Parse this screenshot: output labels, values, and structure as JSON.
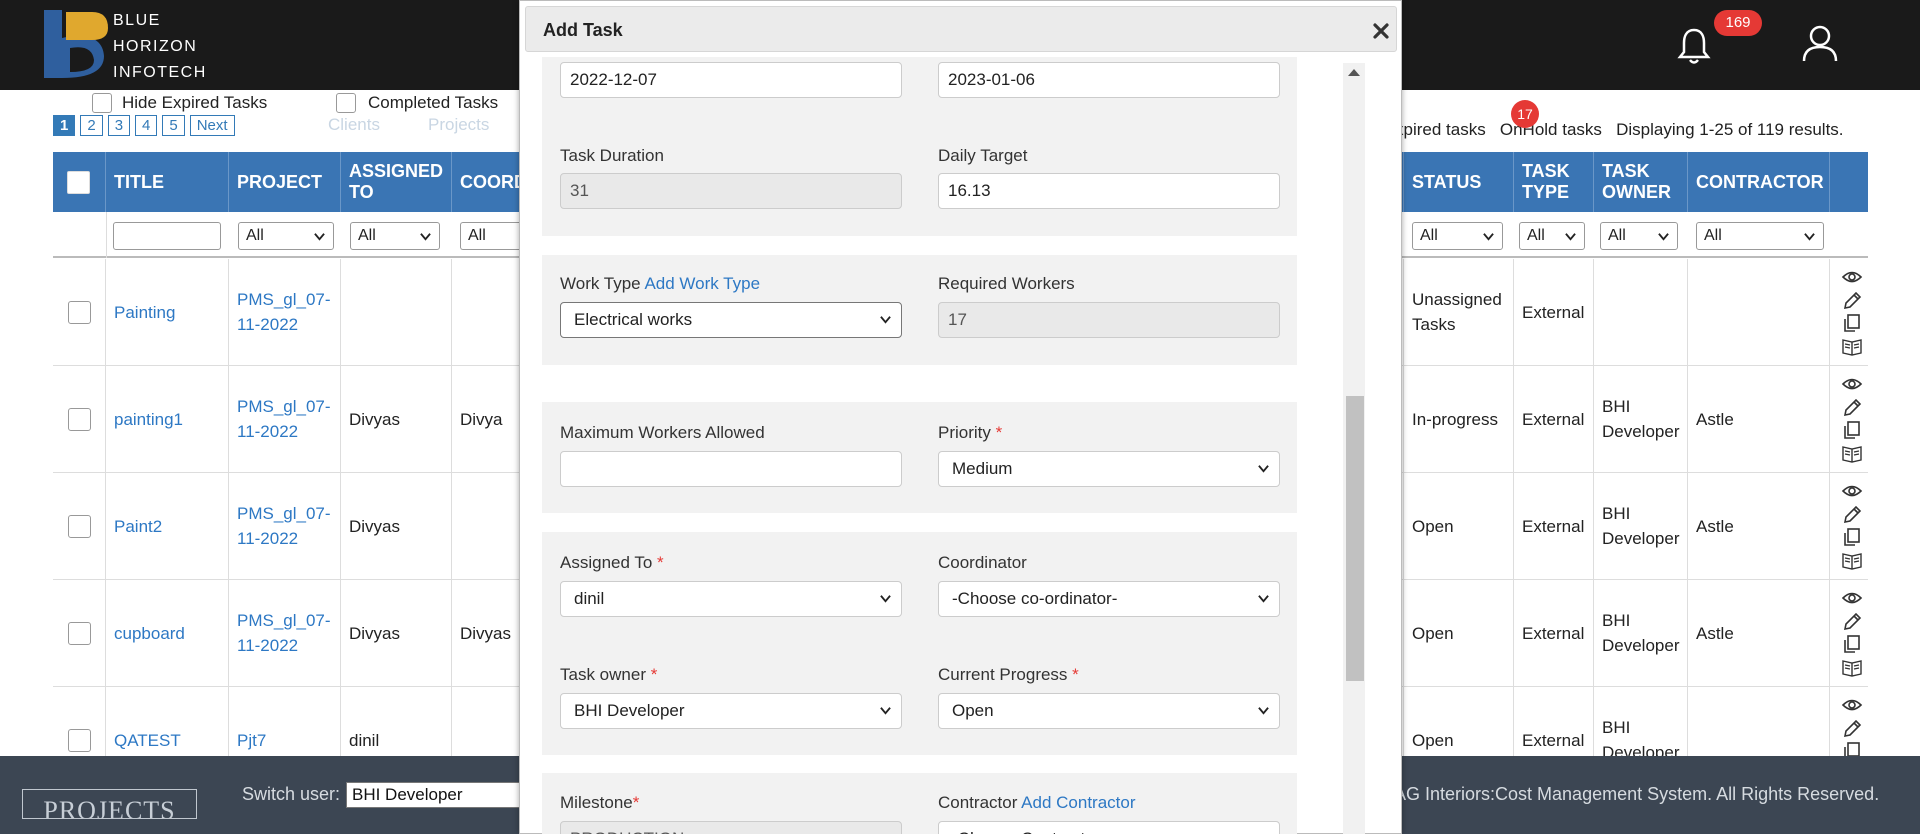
{
  "brand": {
    "line1": "BLUE",
    "line2": "HORIZON",
    "line3": "INFOTECH"
  },
  "header": {
    "notification_count": "169"
  },
  "filters": {
    "hide_expired": "Hide Expired Tasks",
    "completed": "Completed Tasks"
  },
  "pager": [
    "1",
    "2",
    "3",
    "4",
    "5",
    "Next"
  ],
  "ghost_nav": {
    "clients": "Clients",
    "projects": "Projects"
  },
  "task_links": {
    "expired": "xpired tasks",
    "onhold": "OnHold tasks",
    "displaying": "Displaying 1-25 of 119 results.",
    "badge": "17"
  },
  "columns": {
    "title": "TITLE",
    "project": "PROJECT",
    "assigned1": "ASSIGNED",
    "assigned2": "TO",
    "coordinator": "COORD",
    "status": "STATUS",
    "task_type1": "TASK",
    "task_type2": "TYPE",
    "task_owner1": "TASK",
    "task_owner2": "OWNER",
    "contractor": "CONTRACTOR"
  },
  "filter_all": "All",
  "rows": [
    {
      "title": "Painting",
      "project1": "PMS_gl_07-",
      "project2": "11-2022",
      "assigned": "",
      "coordinator": "",
      "status1": "Unassigned",
      "status2": "Tasks",
      "type": "External",
      "owner1": "",
      "owner2": "",
      "contractor": ""
    },
    {
      "title": "painting1",
      "project1": "PMS_gl_07-",
      "project2": "11-2022",
      "assigned": "Divyas",
      "coordinator": "Divya",
      "status1": "In-progress",
      "status2": "",
      "type": "External",
      "owner1": "BHI",
      "owner2": "Developer",
      "contractor": "Astle"
    },
    {
      "title": "Paint2",
      "project1": "PMS_gl_07-",
      "project2": "11-2022",
      "assigned": "Divyas",
      "coordinator": "",
      "status1": "Open",
      "status2": "",
      "type": "External",
      "owner1": "BHI",
      "owner2": "Developer",
      "contractor": "Astle"
    },
    {
      "title": "cupboard",
      "project1": "PMS_gl_07-",
      "project2": "11-2022",
      "assigned": "Divyas",
      "coordinator": "Divyas",
      "status1": "Open",
      "status2": "",
      "type": "External",
      "owner1": "BHI",
      "owner2": "Developer",
      "contractor": "Astle"
    },
    {
      "title": "QATEST",
      "project1": "Pjt7",
      "project2": "",
      "assigned": "dinil",
      "coordinator": "",
      "status1": "Open",
      "status2": "",
      "type": "External",
      "owner1": "BHI",
      "owner2": "Developer",
      "contractor": ""
    }
  ],
  "footer": {
    "projects": "PROJECTS",
    "switch_user": "Switch user:",
    "user": "BHI Developer",
    "copyright": "AG Interiors:Cost Management System. All Rights Reserved."
  },
  "modal": {
    "title": "Add Task",
    "start_date": "2022-12-07",
    "end_date": "2023-01-06",
    "task_duration_label": "Task Duration",
    "task_duration": "31",
    "daily_target_label": "Daily Target",
    "daily_target": "16.13",
    "work_type_label": "Work Type",
    "add_work_type": "Add Work Type",
    "work_type": "Electrical works",
    "required_workers_label": "Required Workers",
    "required_workers": "17",
    "max_workers_label": "Maximum Workers Allowed",
    "max_workers": "",
    "priority_label": "Priority",
    "priority": "Medium",
    "assigned_to_label": "Assigned To",
    "assigned_to": "dinil",
    "coordinator_label": "Coordinator",
    "coordinator": "-Choose co-ordinator-",
    "task_owner_label": "Task owner",
    "task_owner": "BHI Developer",
    "current_progress_label": "Current Progress",
    "current_progress": "Open",
    "milestone_label": "Milestone",
    "milestone": "PRODUCTION",
    "contractor_label": "Contractor",
    "add_contractor": "Add Contractor",
    "contractor": "-Choose Contractor-",
    "required_mark": "*"
  }
}
